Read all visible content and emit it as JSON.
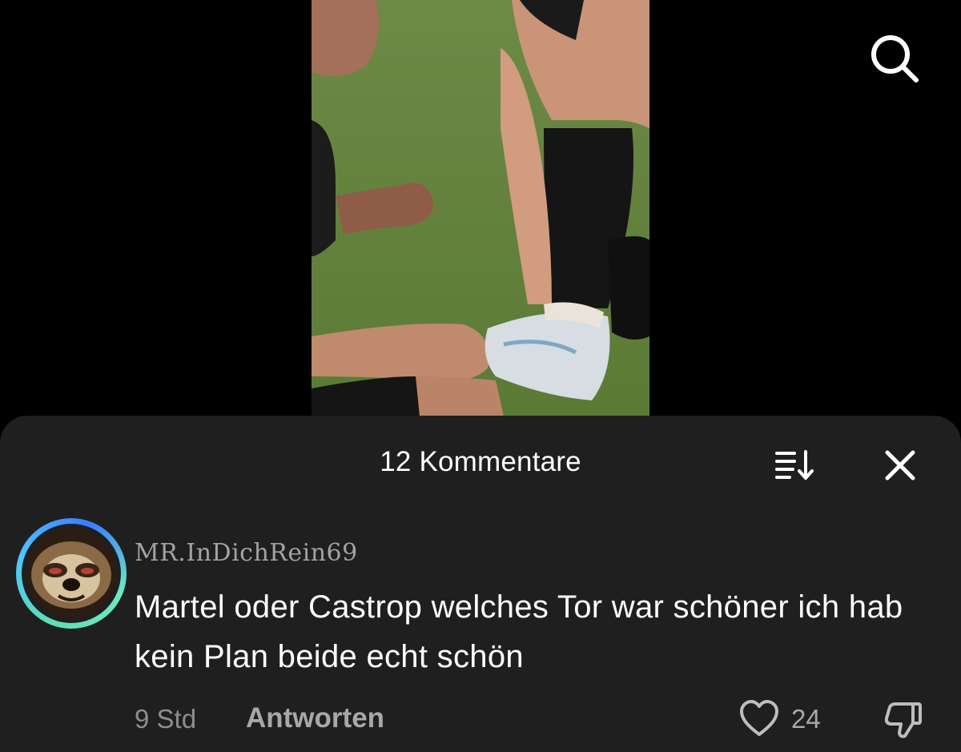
{
  "icons": {
    "search": "search-icon",
    "sort": "sort-icon",
    "close": "close-icon",
    "like": "heart-icon",
    "dislike": "thumbs-down-icon"
  },
  "colors": {
    "background": "#000000",
    "sheet": "#1f1f1f",
    "primary_text": "#ffffff",
    "secondary_text": "#a3a3a3",
    "avatar_ring_start": "#5ee0b0",
    "avatar_ring_end": "#3a7bff"
  },
  "comments_sheet": {
    "title": "12 Kommentare"
  },
  "comment": {
    "username": "MR.InDichRein69",
    "text": "Martel oder Castrop welches Tor war schöner ich hab kein Plan beide echt schön",
    "time": "9 Std",
    "reply_label": "Antworten",
    "like_count": "24"
  }
}
